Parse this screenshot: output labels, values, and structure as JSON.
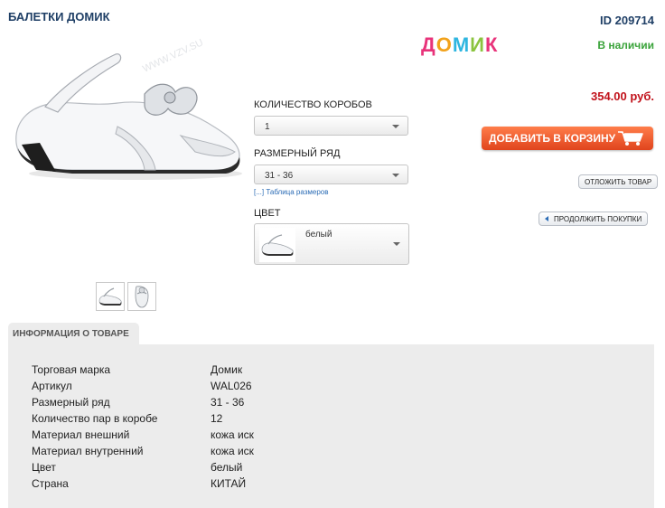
{
  "product": {
    "title": "БАЛЕТКИ ДОМИК",
    "id_label": "ID 209714",
    "brand_logo_letters": [
      "Д",
      "О",
      "М",
      "И",
      "К"
    ],
    "brand_logo_colors": [
      "#e8337a",
      "#f2a21b",
      "#2fb6e0",
      "#8bc43f",
      "#e8337a"
    ],
    "stock": "В наличии",
    "price": "354.00 руб."
  },
  "options": {
    "qty_label": "КОЛИЧЕСТВО КОРОБОВ",
    "qty_value": "1",
    "size_label": "РАЗМЕРНЫЙ РЯД",
    "size_value": "31 - 36",
    "size_table_link": "[...] Таблица размеров",
    "color_label": "ЦВЕТ",
    "color_value": "белый"
  },
  "buttons": {
    "add_to_cart": "ДОБАВИТЬ В КОРЗИНУ",
    "postpone": "ОТЛОЖИТЬ ТОВАР",
    "continue": "ПРОДОЛЖИТЬ ПОКУПКИ"
  },
  "info": {
    "tab_label": "ИНФОРМАЦИЯ О ТОВАРЕ",
    "rows": [
      {
        "key": "Торговая марка",
        "value": "Домик"
      },
      {
        "key": "Артикул",
        "value": "WAL026"
      },
      {
        "key": "Размерный ряд",
        "value": "31 - 36"
      },
      {
        "key": "Количество пар в коробе",
        "value": "12"
      },
      {
        "key": "Материал внешний",
        "value": "кожа иск"
      },
      {
        "key": "Материал внутренний",
        "value": "кожа иск"
      },
      {
        "key": "Цвет",
        "value": "белый"
      },
      {
        "key": "Страна",
        "value": "КИТАЙ"
      }
    ]
  }
}
